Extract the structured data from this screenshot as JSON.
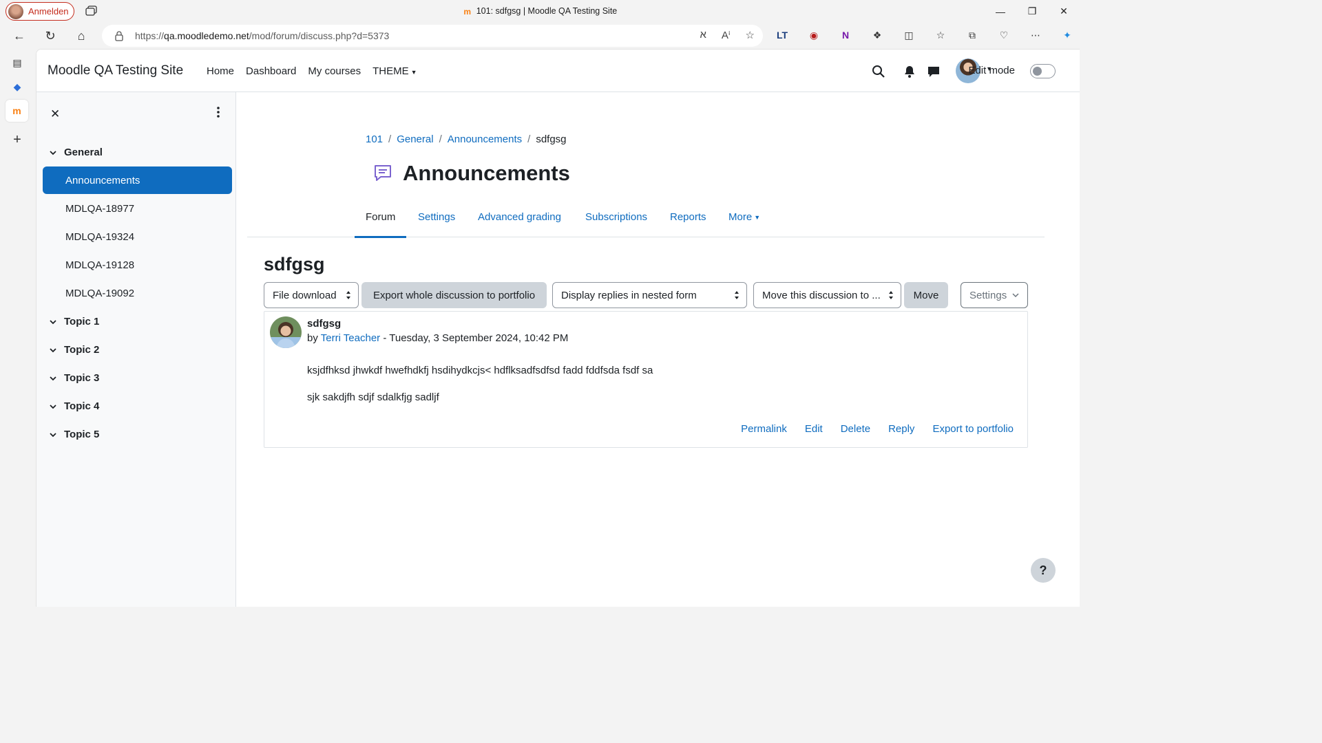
{
  "browser": {
    "profile_label": "Anmelden",
    "window_title": "101: sdfgsg | Moodle QA Testing Site",
    "url_scheme": "https://",
    "url_host": "qa.moodledemo.net",
    "url_path": "/mod/forum/discuss.php?d=5373"
  },
  "navbar": {
    "brand": "Moodle QA Testing Site",
    "items": [
      {
        "label": "Home"
      },
      {
        "label": "Dashboard"
      },
      {
        "label": "My courses"
      },
      {
        "label": "THEME"
      }
    ],
    "edit_mode_label": "Edit mode",
    "edit_mode_on": false
  },
  "course_index": {
    "sections": [
      {
        "name": "General",
        "expanded": true
      },
      {
        "name": "Topic 1"
      },
      {
        "name": "Topic 2"
      },
      {
        "name": "Topic 3"
      },
      {
        "name": "Topic 4"
      },
      {
        "name": "Topic 5"
      }
    ],
    "general_items": [
      {
        "label": "Announcements",
        "active": true
      },
      {
        "label": "MDLQA-18977"
      },
      {
        "label": "MDLQA-19324"
      },
      {
        "label": "MDLQA-19128"
      },
      {
        "label": "MDLQA-19092"
      }
    ]
  },
  "breadcrumb": [
    "101",
    "General",
    "Announcements",
    "sdfgsg"
  ],
  "page_title": "Announcements",
  "secondary_nav": [
    {
      "label": "Forum",
      "active": true
    },
    {
      "label": "Settings"
    },
    {
      "label": "Advanced grading"
    },
    {
      "label": "Subscriptions"
    },
    {
      "label": "Reports"
    },
    {
      "label": "More"
    }
  ],
  "discussion": {
    "title": "sdfgsg",
    "controls": {
      "file_download": "File download",
      "export_portfolio": "Export whole discussion to portfolio",
      "display_mode": "Display replies in nested form",
      "move_to": "Move this discussion to ...",
      "move_button": "Move",
      "settings": "Settings"
    },
    "post": {
      "subject": "sdfgsg",
      "by_prefix": "by",
      "author": "Terri Teacher",
      "date": "- Tuesday, 3 September 2024, 10:42 PM",
      "line1": "ksjdfhksd jhwkdf hwefhdkfj hsdihydkcjs< hdflksadfsdfsd fadd fddfsda fsdf sa",
      "line2": "sjk sakdjfh sdjf sdalkfjg sadljf",
      "actions": [
        "Permalink",
        "Edit",
        "Delete",
        "Reply",
        "Export to portfolio"
      ]
    }
  },
  "help_label": "?",
  "colors": {
    "primary": "#0f6cbf",
    "forum_icon": "#7b63cf",
    "moodle_orange": "#f98012"
  }
}
